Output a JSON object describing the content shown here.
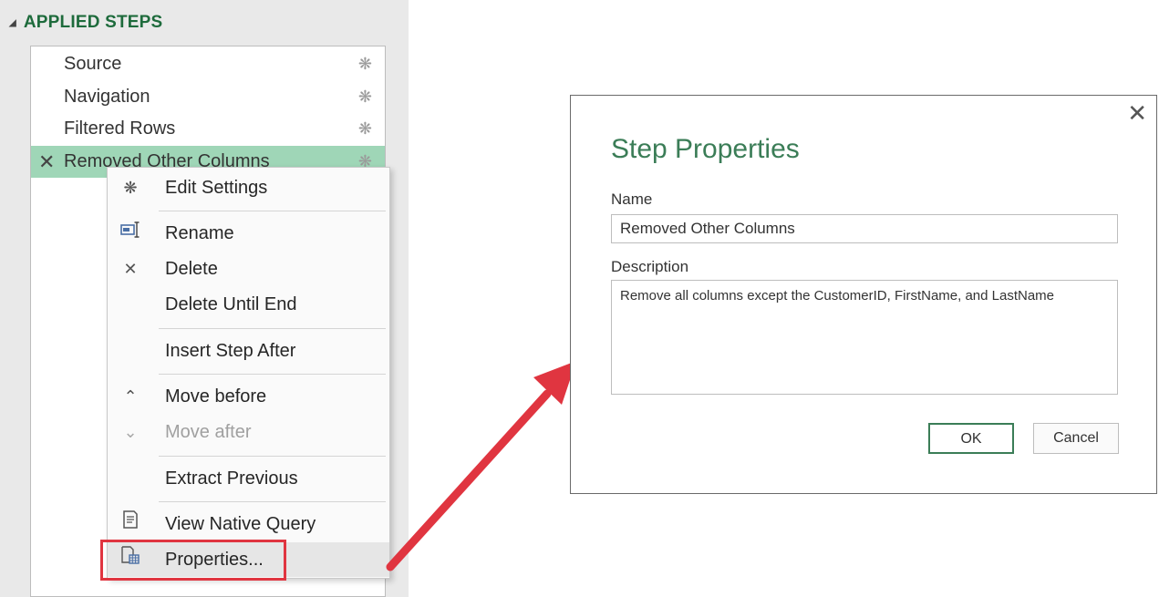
{
  "pane": {
    "header": "APPLIED STEPS",
    "steps": [
      {
        "label": "Source"
      },
      {
        "label": "Navigation"
      },
      {
        "label": "Filtered Rows"
      },
      {
        "label": "Removed Other Columns"
      }
    ]
  },
  "context_menu": {
    "edit_settings": "Edit Settings",
    "rename": "Rename",
    "delete": "Delete",
    "delete_until_end": "Delete Until End",
    "insert_step_after": "Insert Step After",
    "move_before": "Move before",
    "move_after": "Move after",
    "extract_previous": "Extract Previous",
    "view_native_query": "View Native Query",
    "properties": "Properties..."
  },
  "dialog": {
    "title": "Step Properties",
    "name_label": "Name",
    "name_value": "Removed Other Columns",
    "description_label": "Description",
    "description_value": "Remove all columns except the CustomerID, FirstName, and LastName",
    "ok_label": "OK",
    "cancel_label": "Cancel"
  },
  "colors": {
    "accent_green": "#3b7d57",
    "selected_row": "#9fd6b7",
    "highlight_red": "#e03540"
  }
}
